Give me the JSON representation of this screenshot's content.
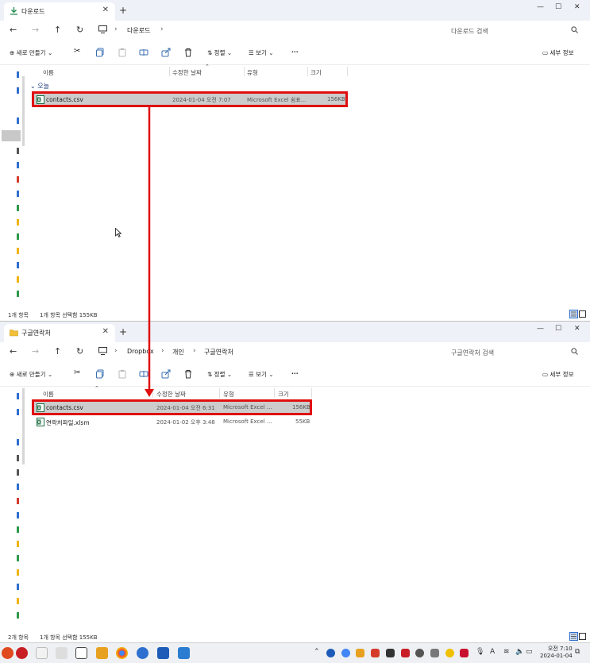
{
  "colors": {
    "highlight_box": "#e01010",
    "selected_row": "#cccccc",
    "excel_green": "#1d6f42",
    "folder_yellow": "#f2c037"
  },
  "window1": {
    "tab_title": "다운로드",
    "breadcrumb": [
      "다운로드"
    ],
    "search_placeholder": "다운로드 검색",
    "toolbar": {
      "new_label": "새로 만들기",
      "sort_label": "정렬",
      "view_label": "보기",
      "details_label": "세부 정보"
    },
    "columns": [
      "이름",
      "수정한 날짜",
      "유형",
      "크기"
    ],
    "group_label": "오늘",
    "files": [
      {
        "name": "contacts.csv",
        "date": "2024-01-04 오전 7:07",
        "type": "Microsoft Excel 쉼표...",
        "size": "156KB"
      }
    ],
    "status": {
      "count": "1개 항목",
      "selected": "1개 항목 선택함 155KB"
    }
  },
  "window2": {
    "tab_title": "구글연락처",
    "breadcrumb": [
      "Dropbox",
      "개인",
      "구글연락처"
    ],
    "search_placeholder": "구글연락처 검색",
    "toolbar": {
      "new_label": "새로 만들기",
      "sort_label": "정렬",
      "view_label": "보기",
      "details_label": "세부 정보"
    },
    "columns": [
      "이름",
      "수정한 날짜",
      "유형",
      "크기"
    ],
    "files": [
      {
        "name": "contacts.csv",
        "date": "2024-01-04 오전 6:31",
        "type": "Microsoft Excel ...",
        "size": "156KB"
      },
      {
        "name": "연락처파일.xlsm",
        "date": "2024-01-02 오후 3:48",
        "type": "Microsoft Excel ...",
        "size": "55KB"
      }
    ],
    "status": {
      "count": "2개 항목",
      "selected": "1개 항목 선택함 155KB"
    }
  },
  "taskbar": {
    "clock_time": "오전 7:10",
    "clock_date": "2024-01-04",
    "tray_letter": "A"
  }
}
